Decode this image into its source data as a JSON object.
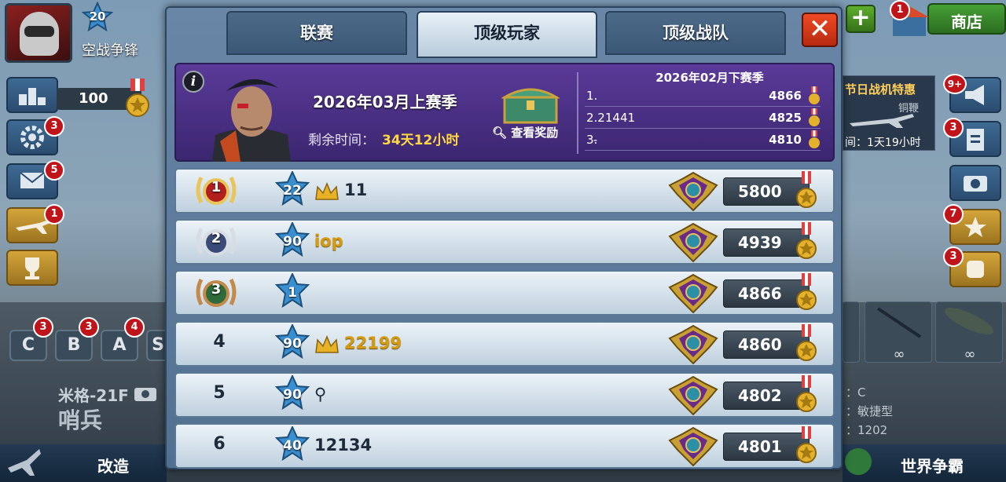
{
  "background": {
    "player": {
      "level": "20",
      "name": "空战争锋"
    },
    "currency_value": "100",
    "side_buttons": [
      {
        "name": "ranking",
        "badge": ""
      },
      {
        "name": "settings",
        "badge": "3"
      },
      {
        "name": "mail",
        "badge": "5"
      },
      {
        "name": "planes",
        "badge": "1"
      },
      {
        "name": "trophy",
        "badge": ""
      }
    ],
    "grades": [
      {
        "label": "C",
        "badge": "3"
      },
      {
        "label": "B",
        "badge": "3"
      },
      {
        "label": "A",
        "badge": "4"
      },
      {
        "label": "S",
        "badge": ""
      }
    ],
    "plane": {
      "name": "米格-21F",
      "type": "哨兵"
    },
    "bottom_left_label": "改造",
    "bottom_right_label": "世界争霸",
    "shop": {
      "label": "商店",
      "badge": "1"
    },
    "promo": {
      "title": "节日战机特惠",
      "subtitle": "铜鞭",
      "timer": "间：1天19小时"
    },
    "right_buttons": [
      {
        "name": "announce",
        "badge": "9+"
      },
      {
        "name": "clipboard",
        "badge": "3"
      },
      {
        "name": "camera",
        "badge": ""
      },
      {
        "name": "emblem",
        "badge": "7"
      },
      {
        "name": "fist",
        "badge": "3"
      }
    ],
    "weapons": [
      {
        "infinite": "∞"
      },
      {
        "infinite": "∞"
      },
      {
        "infinite": "∞"
      }
    ],
    "stats": [
      "：C",
      "：敏捷型",
      "：1202"
    ]
  },
  "tabs": [
    {
      "label": "联赛",
      "active": false
    },
    {
      "label": "顶级玩家",
      "active": true
    },
    {
      "label": "顶级战队",
      "active": false
    }
  ],
  "close_label": "✕",
  "season": {
    "title": "2026年03月上赛季",
    "remaining_label": "剩余时间：",
    "remaining_value": "34天12小时",
    "view_reward_label": "查看奖励",
    "previous": {
      "title": "2026年02月下赛季",
      "rows": [
        {
          "name": "1.",
          "score": "4866"
        },
        {
          "name": "2.21441",
          "score": "4825"
        },
        {
          "name": "3.̵",
          "score": "4810"
        }
      ]
    }
  },
  "players": [
    {
      "rank": "1",
      "medal_color": "gold",
      "level": "22",
      "crown": true,
      "name": "11",
      "name_style": "normal",
      "score": "5800"
    },
    {
      "rank": "2",
      "medal_color": "silver",
      "level": "90",
      "crown": false,
      "name": "iop",
      "name_style": "gold",
      "score": "4939"
    },
    {
      "rank": "3",
      "medal_color": "bronze",
      "level": "1",
      "crown": false,
      "name": "",
      "name_style": "normal",
      "score": "4866"
    },
    {
      "rank": "4",
      "medal_color": "",
      "level": "90",
      "crown": true,
      "name": "22199",
      "name_style": "gold",
      "score": "4860"
    },
    {
      "rank": "5",
      "medal_color": "",
      "level": "90",
      "crown": false,
      "name": "⚲",
      "name_style": "normal",
      "score": "4802"
    },
    {
      "rank": "6",
      "medal_color": "",
      "level": "40",
      "crown": false,
      "name": "12134",
      "name_style": "normal",
      "score": "4801"
    }
  ],
  "colors": {
    "tab_active": "#e8f0f6",
    "season_bg": "#4a2f85",
    "close_btn": "#e0401c",
    "gold_text": "#d59a10",
    "remaining_value": "#ffd840"
  }
}
